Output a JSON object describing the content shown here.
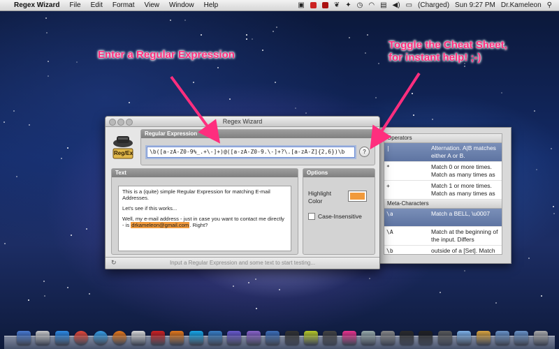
{
  "menubar": {
    "apple_glyph": "",
    "app_name": "Regex Wizard",
    "menus": [
      "File",
      "Edit",
      "Format",
      "View",
      "Window",
      "Help"
    ],
    "battery_text": "(Charged)",
    "clock": "Sun 9:27 PM",
    "user": "Dr.Kameleon"
  },
  "annotations": {
    "left": "Enter a Regular Expression",
    "right_line1": "Toggle the Cheat Sheet,",
    "right_line2": "for instant help! ;-)"
  },
  "window": {
    "title": "Regex Wizard",
    "logo_text": "Reg/Ex",
    "regex_section": "Regular Expression",
    "regex_value": "\\b([a-zA-Z0-9%_.+\\-]+)@([a-zA-Z0-9.\\-]+?\\.[a-zA-Z]{2,6})\\b",
    "help_label": "?",
    "text_section": "Text",
    "text_line1": "This is a (quite) simple Regular Expression for matching E-mail Addresses.",
    "text_line2": "Let's see if this works...",
    "text_line3a": "Well, my e-mail address - just in case you want to contact me directly - is ",
    "text_match": "drkameleon@gmail.com",
    "text_line3b": ". Right?",
    "options_section": "Options",
    "highlight_label": "Highlight Color",
    "highlight_color": "#f19a3c",
    "case_label": "Case-Insensitive",
    "status_text": "Input a Regular Expression and some text to start testing..."
  },
  "cheat_sheet": {
    "operators_header": "Operators",
    "operators": [
      {
        "key": "|",
        "desc": "Alternation. A|B matches either A or B.",
        "selected": true
      },
      {
        "key": "*",
        "desc": "Match 0 or more times. Match as many times as",
        "selected": false
      },
      {
        "key": "+",
        "desc": "Match 1 or more times. Match as many times as",
        "selected": false
      }
    ],
    "meta_header": "Meta-Characters",
    "meta": [
      {
        "key": "\\a",
        "desc": "Match a BELL, \\u0007",
        "selected": true
      },
      {
        "key": "\\A",
        "desc": "Match at the beginning of the input. Differs",
        "selected": false
      },
      {
        "key": "\\b",
        "desc": "outside of a [Set]. Match if the current position is",
        "selected": false
      }
    ]
  },
  "colors": {
    "annotation": "#ff2e7e",
    "match_highlight": "#f19a3c",
    "selected_row": "#6a80ad"
  },
  "dock_icons": [
    "finder-icon",
    "launchpad-icon",
    "app-store-icon",
    "chrome-icon",
    "safari-icon",
    "firefox-icon",
    "flag-icon",
    "poker-icon",
    "xampp-icon",
    "skype-icon",
    "thunderbird-icon",
    "stellarium-icon",
    "app-icon",
    "xcode-icon",
    "terminal-icon",
    "fireworks-icon",
    "fb-icon",
    "heart-icon",
    "app-icon-2",
    "preferences-icon",
    "activity-icon",
    "console-icon",
    "app-icon-3",
    "preview-icon",
    "regex-icon",
    "folder-icon",
    "folder-icon-2",
    "trash-icon"
  ]
}
